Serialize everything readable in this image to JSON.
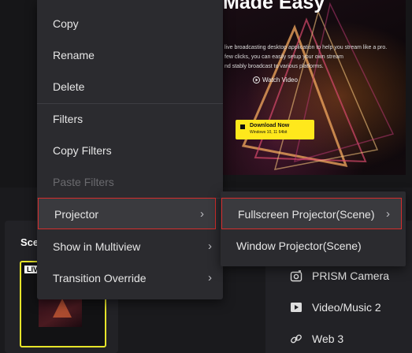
{
  "preview": {
    "title": "Made Easy",
    "subtitle_line1": "live broadcasting desktop application to help you stream like a pro.",
    "subtitle_line2": "few clicks, you can easily setup your own stream",
    "subtitle_line3": "nd stably broadcast to various platforms.",
    "watch_label": "Watch Video",
    "download_label": "Download Now",
    "platforms": "Windows 10, 11  64bit"
  },
  "scenes": {
    "title": "Sce",
    "live_badge": "LIV"
  },
  "sources": {
    "items": [
      {
        "label": "PRISM Camera",
        "icon": "camera-icon"
      },
      {
        "label": "Video/Music 2",
        "icon": "play-icon"
      },
      {
        "label": "Web 3",
        "icon": "link-icon"
      }
    ]
  },
  "context_menu": {
    "items": [
      {
        "label": "Copy",
        "enabled": true
      },
      {
        "label": "Rename",
        "enabled": true
      },
      {
        "label": "Delete",
        "enabled": true
      },
      {
        "label": "Filters",
        "enabled": true
      },
      {
        "label": "Copy Filters",
        "enabled": true
      },
      {
        "label": "Paste Filters",
        "enabled": false
      },
      {
        "label": "Projector",
        "enabled": true,
        "submenu": true,
        "highlighted": true
      },
      {
        "label": "Show in Multiview",
        "enabled": true,
        "submenu": true
      },
      {
        "label": "Transition Override",
        "enabled": true,
        "submenu": true
      }
    ],
    "arrow": "›"
  },
  "submenu": {
    "items": [
      {
        "label": "Fullscreen Projector(Scene)",
        "submenu": true,
        "highlighted": true
      },
      {
        "label": "Window Projector(Scene)",
        "submenu": false
      }
    ]
  },
  "colors": {
    "highlight_border": "#d62d2d",
    "download_button": "#ffe81c",
    "selected_scene_border": "#e7e52a"
  }
}
